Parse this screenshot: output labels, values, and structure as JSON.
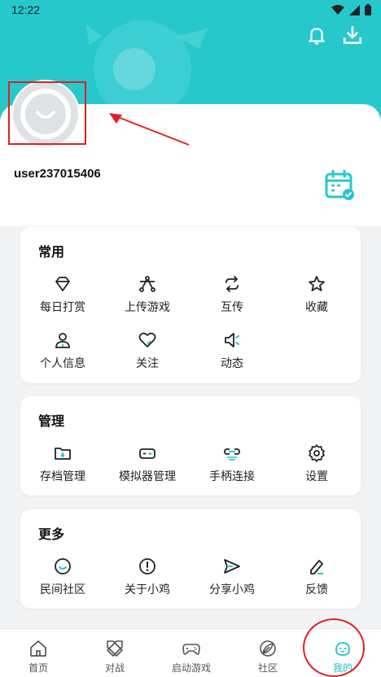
{
  "status_bar": {
    "time": "12:22"
  },
  "user": {
    "username": "user237015406"
  },
  "sections": [
    {
      "title": "常用",
      "items": [
        {
          "label": "每日打赏",
          "icon": "diamond-icon"
        },
        {
          "label": "上传游戏",
          "icon": "upload-game-icon"
        },
        {
          "label": "互传",
          "icon": "transfer-icon"
        },
        {
          "label": "收藏",
          "icon": "star-icon"
        },
        {
          "label": "个人信息",
          "icon": "person-icon"
        },
        {
          "label": "关注",
          "icon": "heart-icon"
        },
        {
          "label": "动态",
          "icon": "speaker-icon"
        }
      ]
    },
    {
      "title": "管理",
      "items": [
        {
          "label": "存档管理",
          "icon": "folder-icon"
        },
        {
          "label": "模拟器管理",
          "icon": "emulator-icon"
        },
        {
          "label": "手柄连接",
          "icon": "link-icon"
        },
        {
          "label": "设置",
          "icon": "gear-icon"
        }
      ]
    },
    {
      "title": "更多",
      "items": [
        {
          "label": "民间社区",
          "icon": "smile-icon"
        },
        {
          "label": "关于小鸡",
          "icon": "info-icon"
        },
        {
          "label": "分享小鸡",
          "icon": "send-icon"
        },
        {
          "label": "反馈",
          "icon": "pencil-icon"
        }
      ]
    }
  ],
  "bottom_nav": [
    {
      "label": "首页",
      "icon": "home-icon"
    },
    {
      "label": "对战",
      "icon": "swords-icon"
    },
    {
      "label": "启动游戏",
      "icon": "gamepad-icon"
    },
    {
      "label": "社区",
      "icon": "leaf-icon"
    },
    {
      "label": "我的",
      "icon": "profile-face-icon",
      "active": true
    }
  ],
  "colors": {
    "accent": "#27c8cc",
    "annotation": "#e02020"
  }
}
